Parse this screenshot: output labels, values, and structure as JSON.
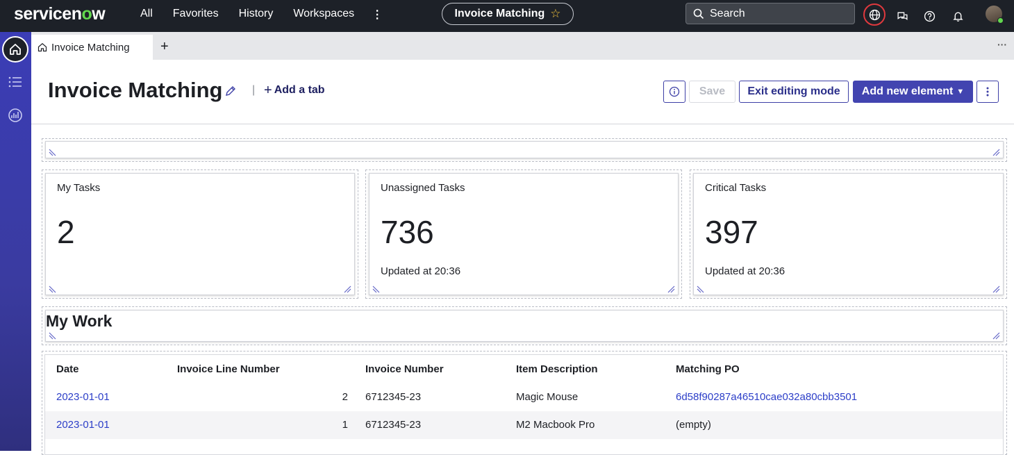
{
  "topbar": {
    "logo": "servicenow",
    "nav": [
      "All",
      "Favorites",
      "History",
      "Workspaces"
    ],
    "more_label": "⋮",
    "workspace_title": "Invoice Matching",
    "search_placeholder": "Search",
    "colors": {
      "bg": "#1d2128",
      "accent_green": "#62d84e",
      "star": "#f4c43b"
    }
  },
  "tabs": {
    "active_label": "Invoice Matching",
    "add_label": "+",
    "more_label": "···"
  },
  "header": {
    "title": "Invoice Matching",
    "separator": "|",
    "add_tab_label": "Add a tab",
    "save_label": "Save",
    "exit_label": "Exit editing mode",
    "add_element_label": "Add new element",
    "colors": {
      "primary": "#4244b0"
    }
  },
  "cards": [
    {
      "title": "My Tasks",
      "value": "2",
      "updated": ""
    },
    {
      "title": "Unassigned Tasks",
      "value": "736",
      "updated": "Updated at 20:36"
    },
    {
      "title": "Critical Tasks",
      "value": "397",
      "updated": "Updated at 20:36"
    }
  ],
  "section_heading": "My Work",
  "table": {
    "headers": [
      "Date",
      "Invoice Line Number",
      "Invoice Number",
      "Item Description",
      "Matching PO"
    ],
    "rows": [
      {
        "date": "2023-01-01",
        "line": "2",
        "invoice": "6712345-23",
        "item": "Magic Mouse",
        "po": "6d58f90287a46510cae032a80cbb3501"
      },
      {
        "date": "2023-01-01",
        "line": "1",
        "invoice": "6712345-23",
        "item": "M2 Macbook Pro",
        "po": "(empty)"
      }
    ]
  }
}
